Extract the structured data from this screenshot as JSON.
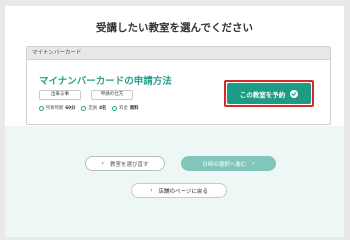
{
  "page": {
    "title": "受講したい教室を選んでください"
  },
  "card": {
    "header": "マイナンバーカード",
    "course_title": "マイナンバーカードの申請方法",
    "tags": [
      "出来る事",
      "申請の仕方"
    ],
    "info": [
      {
        "label": "所要時間",
        "value": "60分",
        "icon": "clock-icon"
      },
      {
        "label": "定員",
        "value": "4名",
        "icon": "people-icon"
      },
      {
        "label": "料金",
        "value": "無料",
        "icon": "yen-icon"
      }
    ],
    "reserve_label": "この教室を予約"
  },
  "buttons": {
    "back_label": "教室を選び直す",
    "next_label": "日時の選択へ進む",
    "store_label": "店舗のページに戻る"
  },
  "colors": {
    "accent": "#1e9b84",
    "highlight": "#d42a2a",
    "next_disabled": "#82c6b9"
  }
}
